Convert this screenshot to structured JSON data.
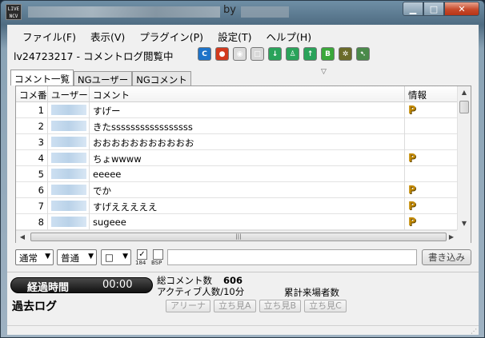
{
  "window": {
    "title_suffix": "by",
    "app_icon_text": "LIVE NCV"
  },
  "menu": [
    "ファイル(F)",
    "表示(V)",
    "プラグイン(P)",
    "設定(T)",
    "ヘルプ(H)"
  ],
  "status_line": "lv24723217 - コメントログ閲覧中",
  "toolbar_icons": [
    {
      "name": "refresh-icon",
      "color": "#1e73c8",
      "glyph": "C"
    },
    {
      "name": "record-icon",
      "color": "#d23a1e",
      "glyph": "●"
    },
    {
      "name": "broadcast-icon",
      "color": "#dcdcdc",
      "glyph": "◉"
    },
    {
      "name": "disabled-icon",
      "color": "#d8d8d8",
      "glyph": "□"
    },
    {
      "name": "download-icon",
      "color": "#2aa35a",
      "glyph": "↓"
    },
    {
      "name": "people-icon",
      "color": "#2aa35a",
      "glyph": "♙"
    },
    {
      "name": "upload-icon",
      "color": "#2aa35a",
      "glyph": "↑"
    },
    {
      "name": "bsp-icon",
      "color": "#3aa83a",
      "glyph": "B"
    },
    {
      "name": "settings-icon",
      "color": "#6b6b2a",
      "glyph": "✲"
    },
    {
      "name": "pin-icon",
      "color": "#4a8a4a",
      "glyph": "➷"
    }
  ],
  "tabs": [
    "コメント一覧",
    "NGユーザー",
    "NGコメント"
  ],
  "grid": {
    "headers": [
      "コメ番",
      "ユーザー...",
      "コメント",
      "情報"
    ],
    "rows": [
      {
        "num": "1",
        "comment": "すげー",
        "premium": true
      },
      {
        "num": "2",
        "comment": "きたsssssssssssssssss",
        "premium": false
      },
      {
        "num": "3",
        "comment": "おおおおおおおおおおお",
        "premium": false
      },
      {
        "num": "4",
        "comment": "ちょwwww",
        "premium": true
      },
      {
        "num": "5",
        "comment": "eeeee",
        "premium": false
      },
      {
        "num": "6",
        "comment": "でか",
        "premium": true
      },
      {
        "num": "7",
        "comment": "すげえええええ",
        "premium": true
      },
      {
        "num": "8",
        "comment": "sugeee",
        "premium": true
      }
    ],
    "premium_mark": "P"
  },
  "input_row": {
    "position_select": "通常",
    "size_select": "普通",
    "color_select": "□",
    "check_184_label": "184",
    "check_184": "✓",
    "check_bsp_label": "BSP",
    "write_button": "書き込み"
  },
  "stats": {
    "elapsed_label": "経過時間",
    "elapsed_time": "00:00",
    "past_log_label": "過去ログ",
    "total_comments_label": "総コメント数",
    "total_comments_value": "606",
    "active_label": "アクティブ人数/10分",
    "visitors_label": "累計来場者数"
  },
  "seat_buttons": [
    "アリーナ",
    "立ち見A",
    "立ち見B",
    "立ち見C"
  ]
}
